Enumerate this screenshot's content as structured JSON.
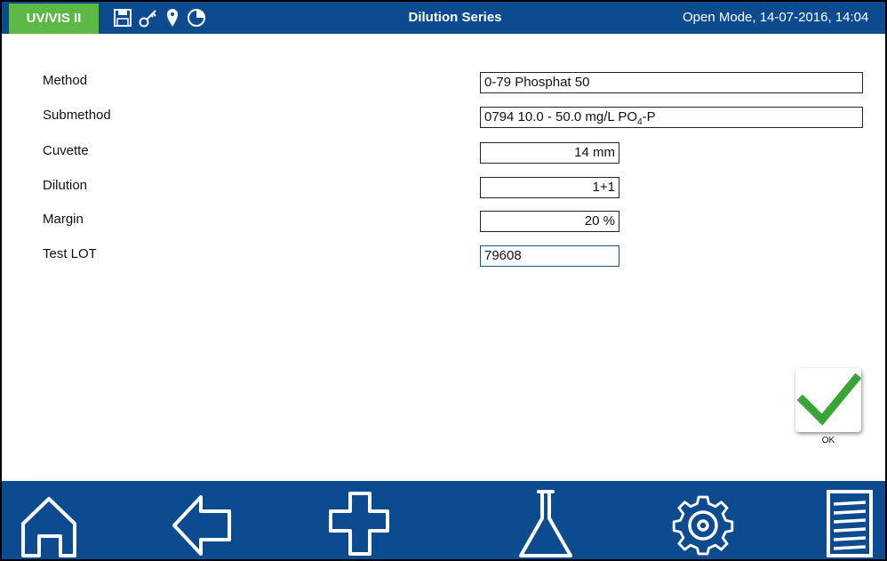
{
  "header": {
    "brand": "UV/VIS II",
    "title": "Dilution Series",
    "status": "Open Mode, 14-07-2016, 14:04",
    "status_icons": [
      "save-icon",
      "key-icon",
      "location-pin-icon",
      "timer-icon"
    ]
  },
  "form": {
    "method_label": "Method",
    "method_value": "0-79 Phosphat 50",
    "submethod_label": "Submethod",
    "submethod_value_main": "0794 10.0 - 50.0 mg/L PO",
    "submethod_value_sub": "4",
    "submethod_value_tail": "-P",
    "cuvette_label": "Cuvette",
    "cuvette_value": "14 mm",
    "dilution_label": "Dilution",
    "dilution_value": "1+1",
    "margin_label": "Margin",
    "margin_value": "20 %",
    "test_lot_label": "Test LOT",
    "test_lot_value": "79608"
  },
  "actions": {
    "ok_label": "OK",
    "ok_icon": "checkmark-icon"
  },
  "navigation": {
    "buttons": [
      "home-icon",
      "back-arrow-icon",
      "plus-icon",
      "flask-icon",
      "gear-icon",
      "list-icon"
    ]
  },
  "colors": {
    "bar_blue": "#0d4b91",
    "brand_green": "#5bb945",
    "check_green": "#3aa435"
  }
}
